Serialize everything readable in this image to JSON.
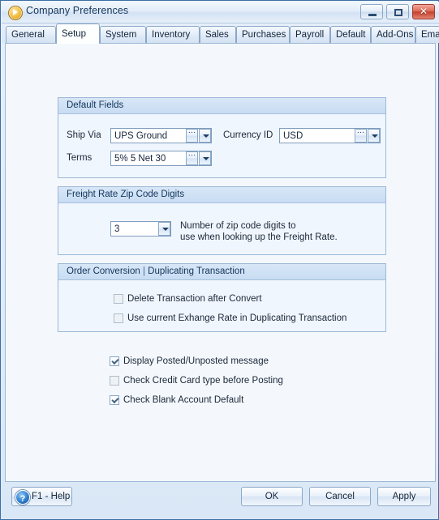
{
  "window": {
    "title": "Company Preferences",
    "icon": "play-circle-icon",
    "controls": {
      "minimize": "minimize-icon",
      "maximize": "maximize-icon",
      "close": "close-icon",
      "close_glyph": "✕"
    }
  },
  "tabs": [
    {
      "label": "General",
      "active": false
    },
    {
      "label": "Setup",
      "active": true
    },
    {
      "label": "System",
      "active": false
    },
    {
      "label": "Inventory",
      "active": false
    },
    {
      "label": "Sales",
      "active": false
    },
    {
      "label": "Purchases",
      "active": false
    },
    {
      "label": "Payroll",
      "active": false
    },
    {
      "label": "Default",
      "active": false
    },
    {
      "label": "Add-Ons",
      "active": false
    },
    {
      "label": "Email Setup",
      "active": false
    }
  ],
  "groups": {
    "default_fields": {
      "title": "Default Fields",
      "ship_via": {
        "label": "Ship Via",
        "value": "UPS Ground"
      },
      "terms": {
        "label": "Terms",
        "value": "5% 5 Net 30"
      },
      "currency_id": {
        "label": "Currency ID",
        "value": "USD"
      }
    },
    "freight_rate": {
      "title": "Freight Rate Zip Code Digits",
      "digits_value": "3",
      "description": "Number of zip code digits to\nuse when looking up the Freight Rate."
    },
    "order_conversion": {
      "title_part1": "Order Conversion",
      "title_separator": "|",
      "title_part2": "Duplicating Transaction",
      "checkboxes": [
        {
          "label": "Delete Transaction after Convert",
          "checked": false
        },
        {
          "label": "Use current Exhange Rate in Duplicating Transaction",
          "checked": false
        }
      ]
    }
  },
  "standalone_checkboxes": [
    {
      "label": "Display Posted/Unposted message",
      "checked": true
    },
    {
      "label": "Check Credit Card type before Posting",
      "checked": false
    },
    {
      "label": "Check Blank Account Default",
      "checked": true
    }
  ],
  "footer": {
    "help_label": "F1 - Help",
    "ok_label": "OK",
    "cancel_label": "Cancel",
    "apply_label": "Apply"
  },
  "colors": {
    "window_border": "#3c6ea5",
    "group_header": "#cfe0f2",
    "content_bg": "#f4f8fd",
    "close_button": "#c6412c",
    "title_text": "#15365c"
  }
}
